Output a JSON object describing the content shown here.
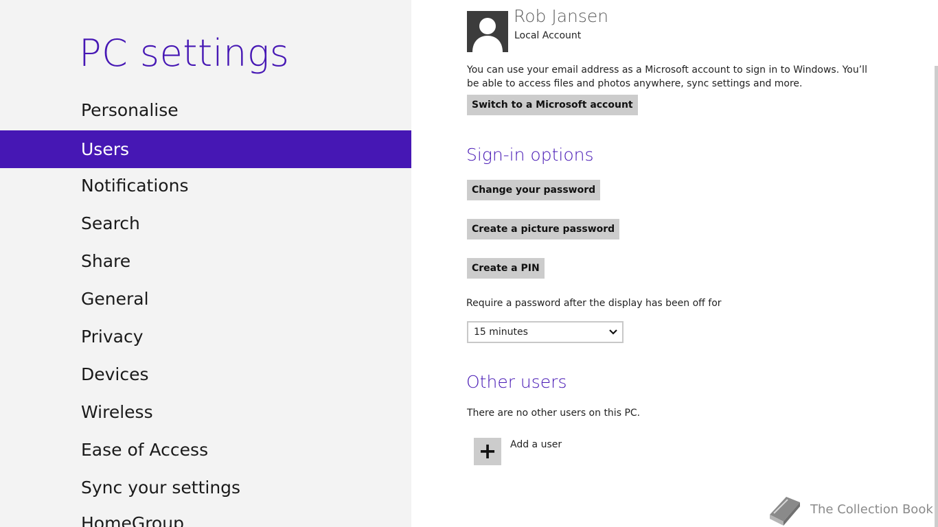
{
  "sidebar": {
    "title": "PC settings",
    "items": [
      {
        "label": "Personalise"
      },
      {
        "label": "Users"
      },
      {
        "label": "Notifications"
      },
      {
        "label": "Search"
      },
      {
        "label": "Share"
      },
      {
        "label": "General"
      },
      {
        "label": "Privacy"
      },
      {
        "label": "Devices"
      },
      {
        "label": "Wireless"
      },
      {
        "label": "Ease of Access"
      },
      {
        "label": "Sync your settings"
      },
      {
        "label": "HomeGroup"
      }
    ],
    "selected": "Users"
  },
  "account": {
    "name": "Rob Jansen",
    "type": "Local Account",
    "description": "You can use your email address as a Microsoft account to sign in to Windows. You’ll be able to access files and photos anywhere, sync settings and more.",
    "switch_label": "Switch to a Microsoft account"
  },
  "signin": {
    "heading": "Sign-in options",
    "change_password_label": "Change your password",
    "picture_password_label": "Create a picture password",
    "pin_label": "Create a PIN",
    "require_label": "Require a password after the display has been off for",
    "require_value": "15 minutes"
  },
  "other_users": {
    "heading": "Other users",
    "none_text": "There are no other users on this PC.",
    "add_label": "Add a user",
    "add_symbol": "+"
  },
  "watermark": {
    "text": "The Collection Book"
  },
  "colors": {
    "accent": "#4617b4",
    "sidebar_bg": "#f3f3f3",
    "button_bg": "#cccccc"
  }
}
